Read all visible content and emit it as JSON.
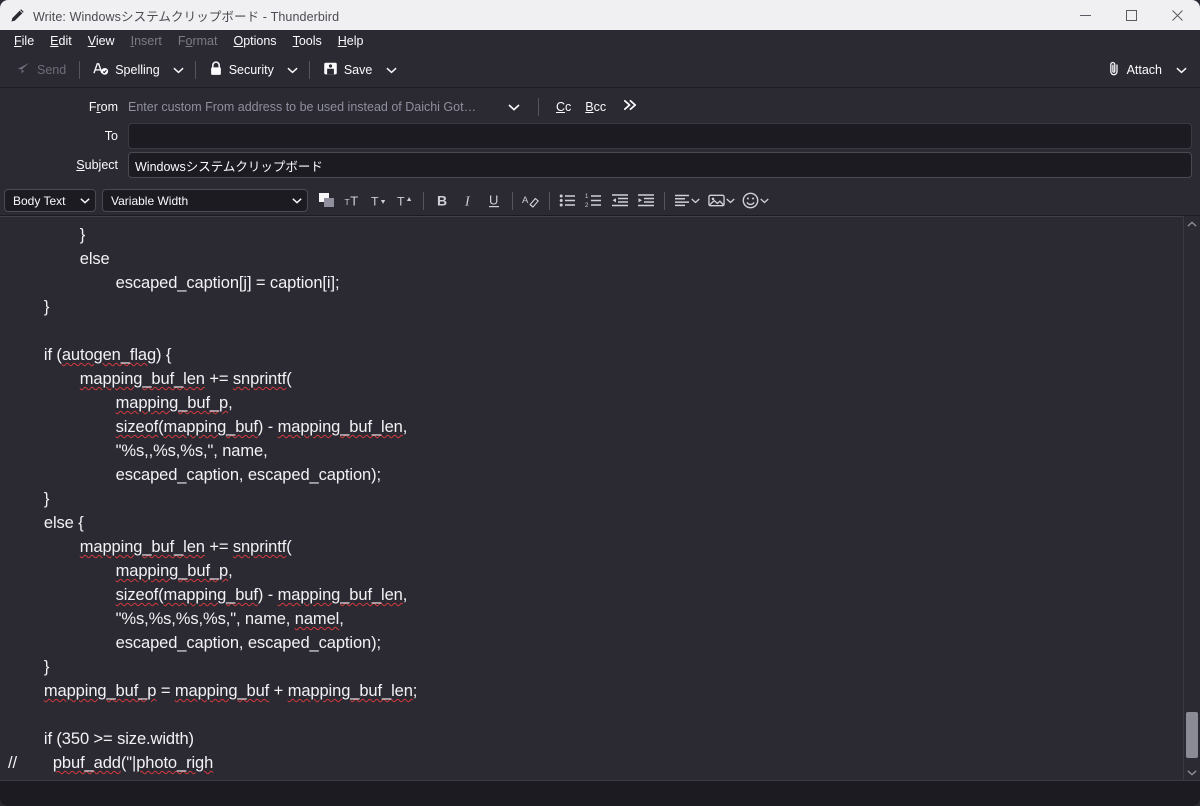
{
  "window": {
    "title": "Write: Windowsシステムクリップボード - Thunderbird",
    "app_icon": "pencil-icon",
    "controls": {
      "minimize": "minimize-icon",
      "maximize": "maximize-icon",
      "close": "close-icon"
    },
    "colors": {
      "titlebar_bg": "#f0f0f2",
      "chrome_bg": "#2b2a33",
      "field_bg": "#1c1b22",
      "text": "#fbfbfe",
      "muted_text": "#8f8f9d",
      "spellcheck_underline": "#d33a3a"
    }
  },
  "menubar": {
    "items": [
      {
        "label": "File",
        "accel": "F",
        "disabled": false
      },
      {
        "label": "Edit",
        "accel": "E",
        "disabled": false
      },
      {
        "label": "View",
        "accel": "V",
        "disabled": false
      },
      {
        "label": "Insert",
        "accel": "I",
        "disabled": true
      },
      {
        "label": "Format",
        "accel": "o",
        "disabled": true
      },
      {
        "label": "Options",
        "accel": "O",
        "disabled": false
      },
      {
        "label": "Tools",
        "accel": "T",
        "disabled": false
      },
      {
        "label": "Help",
        "accel": "H",
        "disabled": false
      }
    ]
  },
  "compose_toolbar": {
    "send": {
      "label": "Send",
      "icon": "send-paperplane-icon",
      "disabled": true
    },
    "spelling": {
      "label": "Spelling",
      "icon": "spellcheck-icon"
    },
    "security": {
      "label": "Security",
      "icon": "lock-icon"
    },
    "save": {
      "label": "Save",
      "icon": "floppy-disk-icon"
    },
    "attach": {
      "label": "Attach",
      "icon": "paperclip-icon"
    },
    "caret_icon": "chevron-down-icon"
  },
  "headers": {
    "from": {
      "label": "From",
      "accel": "r",
      "placeholder": "Enter custom From address to be used instead of Daichi Goto ·",
      "value": "",
      "caret_icon": "chevron-down-icon"
    },
    "cc": {
      "label": "Cc",
      "accel": "C"
    },
    "bcc": {
      "label": "Bcc",
      "accel": "B"
    },
    "more": {
      "label": "»",
      "icon": "double-chevron-right-icon"
    },
    "to": {
      "label": "To",
      "value": ""
    },
    "subject": {
      "label": "Subject",
      "accel": "S",
      "value": "Windowsシステムクリップボード"
    }
  },
  "format_toolbar": {
    "paragraph_style": {
      "selected": "Body Text",
      "caret_icon": "chevron-down-icon"
    },
    "font_family": {
      "selected": "Variable Width",
      "caret_icon": "chevron-down-icon"
    },
    "buttons": [
      {
        "name": "text-color-icon",
        "title": "Color"
      },
      {
        "name": "increase-font-size-icon",
        "title": "Larger"
      },
      {
        "name": "decrease-font-size-icon",
        "title": "Smaller"
      },
      {
        "name": "font-size-icon",
        "title": "Size"
      },
      {
        "name": "bold-icon",
        "title": "Bold",
        "glyph": "B"
      },
      {
        "name": "italic-icon",
        "title": "Italic",
        "glyph": "I"
      },
      {
        "name": "underline-icon",
        "title": "Underline",
        "glyph": "U"
      },
      {
        "name": "remove-formatting-icon",
        "title": "Remove Text Styling"
      },
      {
        "name": "bullet-list-icon",
        "title": "Unordered List"
      },
      {
        "name": "numbered-list-icon",
        "title": "Ordered List"
      },
      {
        "name": "outdent-icon",
        "title": "Decrease Indent"
      },
      {
        "name": "indent-icon",
        "title": "Increase Indent"
      },
      {
        "name": "align-icon",
        "title": "Align"
      },
      {
        "name": "insert-image-icon",
        "title": "Insert"
      },
      {
        "name": "emoji-icon",
        "title": "Smiley"
      }
    ]
  },
  "body": {
    "lines": [
      {
        "indent": 2,
        "segments": [
          {
            "t": "}"
          }
        ]
      },
      {
        "indent": 2,
        "segments": [
          {
            "t": "else"
          }
        ]
      },
      {
        "indent": 3,
        "segments": [
          {
            "t": "escaped_caption[j] = caption[i];",
            "sp": false
          }
        ]
      },
      {
        "indent": 1,
        "segments": [
          {
            "t": "}"
          }
        ]
      },
      {
        "indent": 0,
        "segments": [
          {
            "t": ""
          }
        ]
      },
      {
        "indent": 1,
        "segments": [
          {
            "t": "if ("
          },
          {
            "t": "autogen_flag",
            "sp": true
          },
          {
            "t": ") {"
          }
        ]
      },
      {
        "indent": 2,
        "segments": [
          {
            "t": "mapping_buf_len",
            "sp": true
          },
          {
            "t": " += "
          },
          {
            "t": "snprintf",
            "sp": true
          },
          {
            "t": "("
          }
        ]
      },
      {
        "indent": 3,
        "segments": [
          {
            "t": "mapping_buf_p",
            "sp": true
          },
          {
            "t": ","
          }
        ]
      },
      {
        "indent": 3,
        "segments": [
          {
            "t": "sizeof",
            "sp": true
          },
          {
            "t": "("
          },
          {
            "t": "mapping_buf",
            "sp": true
          },
          {
            "t": ") - "
          },
          {
            "t": "mapping_buf_len",
            "sp": true
          },
          {
            "t": ","
          }
        ]
      },
      {
        "indent": 3,
        "segments": [
          {
            "t": "\"%s,,%s,%s,\", name,"
          }
        ]
      },
      {
        "indent": 3,
        "segments": [
          {
            "t": "escaped_caption, escaped_caption);"
          }
        ]
      },
      {
        "indent": 1,
        "segments": [
          {
            "t": "}"
          }
        ]
      },
      {
        "indent": 1,
        "segments": [
          {
            "t": "else {"
          }
        ]
      },
      {
        "indent": 2,
        "segments": [
          {
            "t": "mapping_buf_len",
            "sp": true
          },
          {
            "t": " += "
          },
          {
            "t": "snprintf",
            "sp": true
          },
          {
            "t": "("
          }
        ]
      },
      {
        "indent": 3,
        "segments": [
          {
            "t": "mapping_buf_p",
            "sp": true
          },
          {
            "t": ","
          }
        ]
      },
      {
        "indent": 3,
        "segments": [
          {
            "t": "sizeof",
            "sp": true
          },
          {
            "t": "("
          },
          {
            "t": "mapping_buf",
            "sp": true
          },
          {
            "t": ") - "
          },
          {
            "t": "mapping_buf_len",
            "sp": true
          },
          {
            "t": ","
          }
        ]
      },
      {
        "indent": 3,
        "segments": [
          {
            "t": "\"%s,%s,%s,%s,\", name, "
          },
          {
            "t": "namel",
            "sp": true
          },
          {
            "t": ","
          }
        ]
      },
      {
        "indent": 3,
        "segments": [
          {
            "t": "escaped_caption, escaped_caption);"
          }
        ]
      },
      {
        "indent": 1,
        "segments": [
          {
            "t": "}"
          }
        ]
      },
      {
        "indent": 1,
        "segments": [
          {
            "t": "mapping_buf_p",
            "sp": true
          },
          {
            "t": " = "
          },
          {
            "t": "mapping_buf",
            "sp": true
          },
          {
            "t": " + "
          },
          {
            "t": "mapping_buf_len",
            "sp": true
          },
          {
            "t": ";"
          }
        ]
      },
      {
        "indent": 0,
        "segments": [
          {
            "t": ""
          }
        ]
      },
      {
        "indent": 1,
        "segments": [
          {
            "t": "if (350 >= size.width)"
          }
        ]
      },
      {
        "indent": 0,
        "prefix": "//",
        "segments": [
          {
            "t": "        "
          },
          {
            "t": "pbuf_add",
            "sp": true
          },
          {
            "t": "(\"|"
          },
          {
            "t": "photo_righ",
            "sp": true
          }
        ]
      }
    ]
  },
  "scrollbar": {
    "up_icon": "chevron-up-icon",
    "down_icon": "chevron-down-icon",
    "thumb_position": "bottom"
  },
  "statusbar": {
    "text": ""
  }
}
